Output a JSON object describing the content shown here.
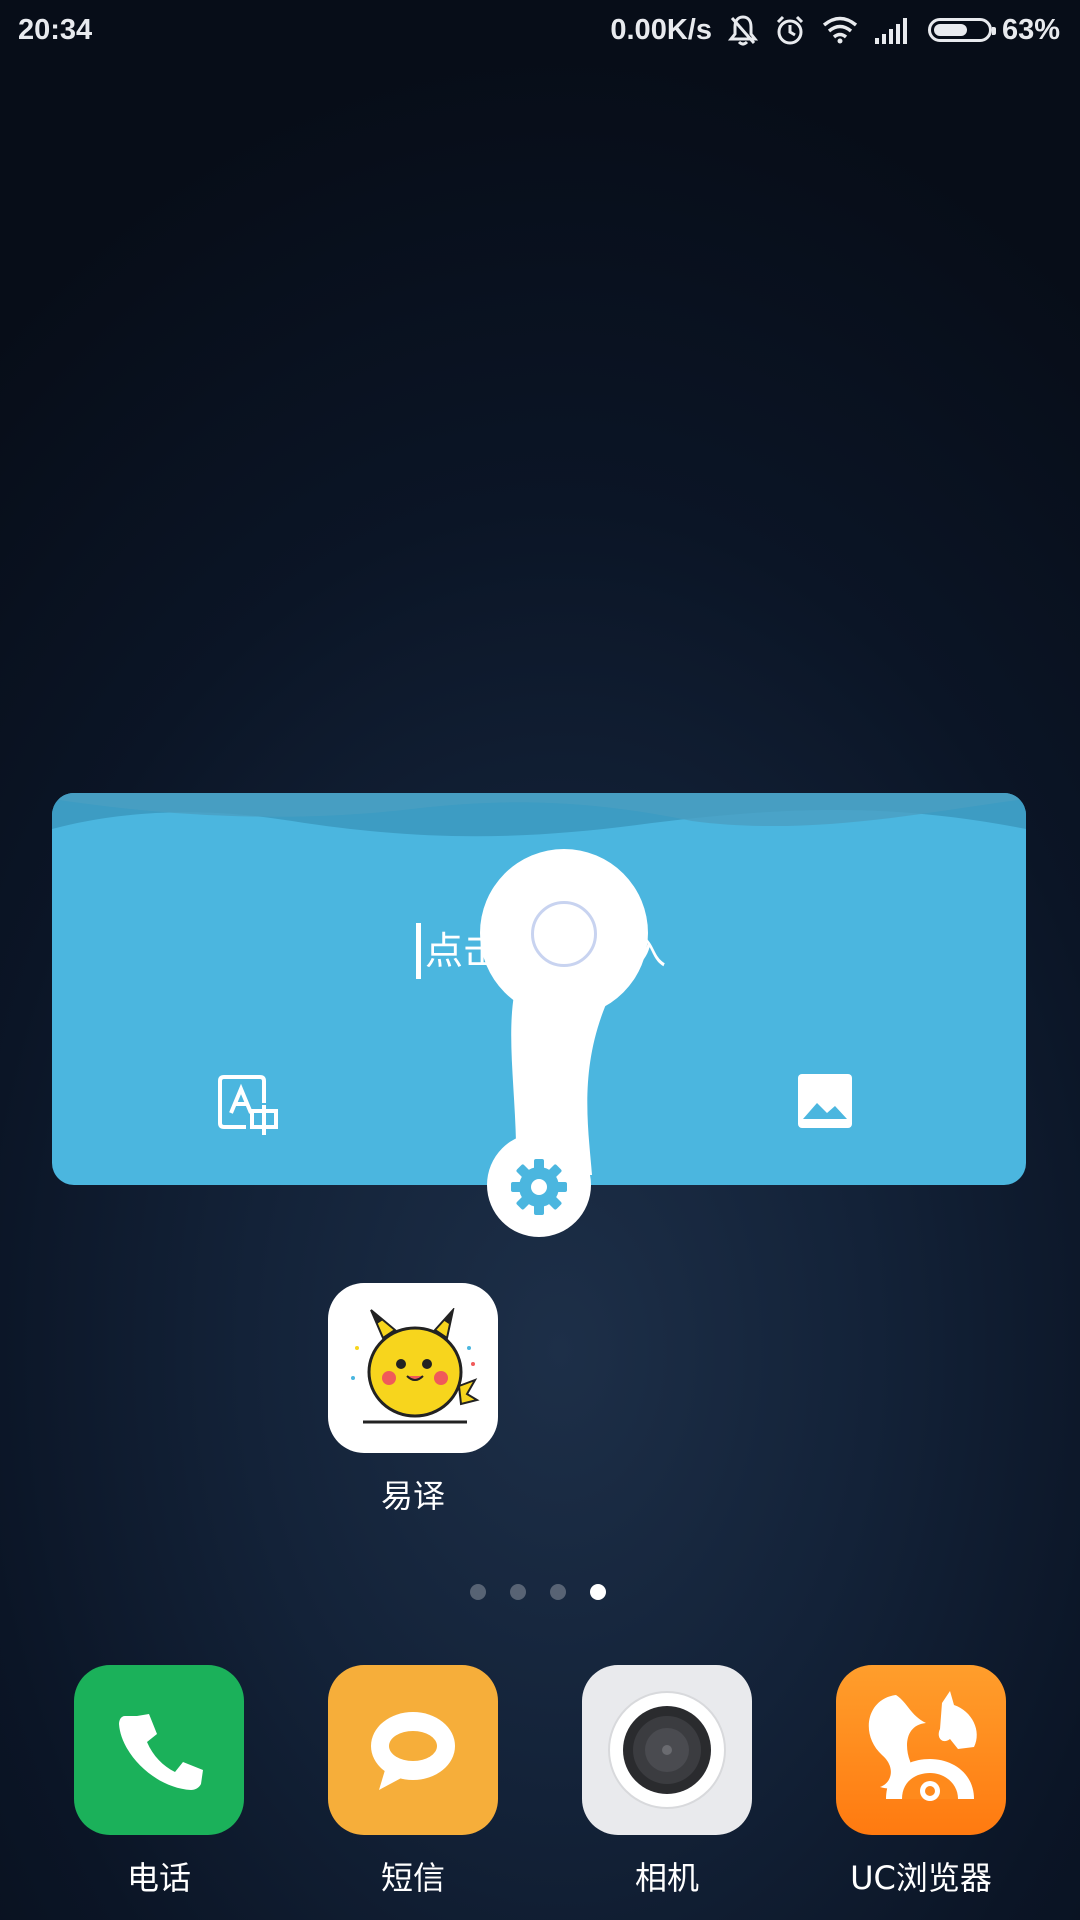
{
  "status_bar": {
    "time": "20:34",
    "net_speed": "0.00K/s",
    "battery_percent": "63%",
    "battery_level": 0.63,
    "icons": [
      "bell-off-icon",
      "alarm-icon",
      "wifi-icon",
      "signal-icon",
      "battery-icon"
    ]
  },
  "widget": {
    "input_placeholder_visible": "点击",
    "input_tail_visible": "入",
    "left_button_icon": "text-recognition-icon",
    "right_button_icon": "image-icon",
    "colors": {
      "background": "#4bb6df",
      "wave": "#3d9cc3"
    }
  },
  "assist_ball": {
    "icons": [
      "ring-icon",
      "gear-icon"
    ],
    "accent": "#4bb6df"
  },
  "desktop_apps": [
    {
      "label": "易译",
      "icon": "pikachu-icon"
    }
  ],
  "page_indicator": {
    "count": 4,
    "active": 4
  },
  "dock": [
    {
      "label": "电话",
      "icon": "phone-icon",
      "color": "#1bb15a"
    },
    {
      "label": "短信",
      "icon": "message-icon",
      "color": "#f6ae3a"
    },
    {
      "label": "相机",
      "icon": "camera-icon",
      "color": "#e9eaed"
    },
    {
      "label": "UC浏览器",
      "icon": "uc-squirrel-icon",
      "color": "#ff8a1c"
    }
  ]
}
